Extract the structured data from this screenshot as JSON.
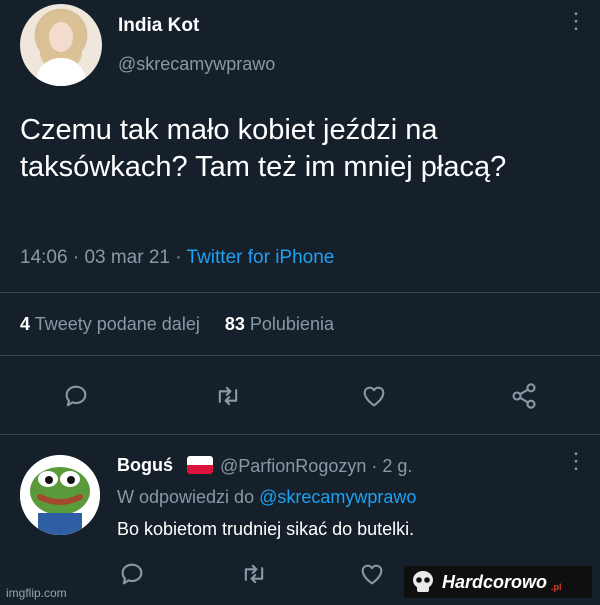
{
  "tweet": {
    "author_name": "India Kot",
    "author_handle": "@skrecamywprawo",
    "text": "Czemu tak mało kobiet jeździ na taksówkach? Tam też im mniej płacą?",
    "time": "14:06",
    "date": "03 mar 21",
    "separator": " · ",
    "source": "Twitter for iPhone",
    "retweets_count": "4",
    "retweets_label": "Tweety podane dalej",
    "likes_count": "83",
    "likes_label": "Polubienia"
  },
  "reply": {
    "author_name": "Boguś",
    "author_handle": "@ParfionRogozyn",
    "age": "2 g.",
    "reply_to_prefix": "W odpowiedzi do",
    "reply_to_handle": "@skrecamywprawo",
    "text": "Bo kobietom trudniej sikać do butelki."
  },
  "icons": {
    "reply": "comment-icon",
    "retweet": "retweet-icon",
    "like": "heart-icon",
    "share": "share-icon",
    "more": "more-vertical-icon"
  },
  "colors": {
    "background": "#15202b",
    "muted_text": "#8899a6",
    "link": "#1da1f2",
    "divider": "#38444d"
  },
  "watermark": {
    "imgflip": "imgflip.com",
    "logo_text": "Hardcorowo",
    "logo_suffix": ".pl"
  }
}
